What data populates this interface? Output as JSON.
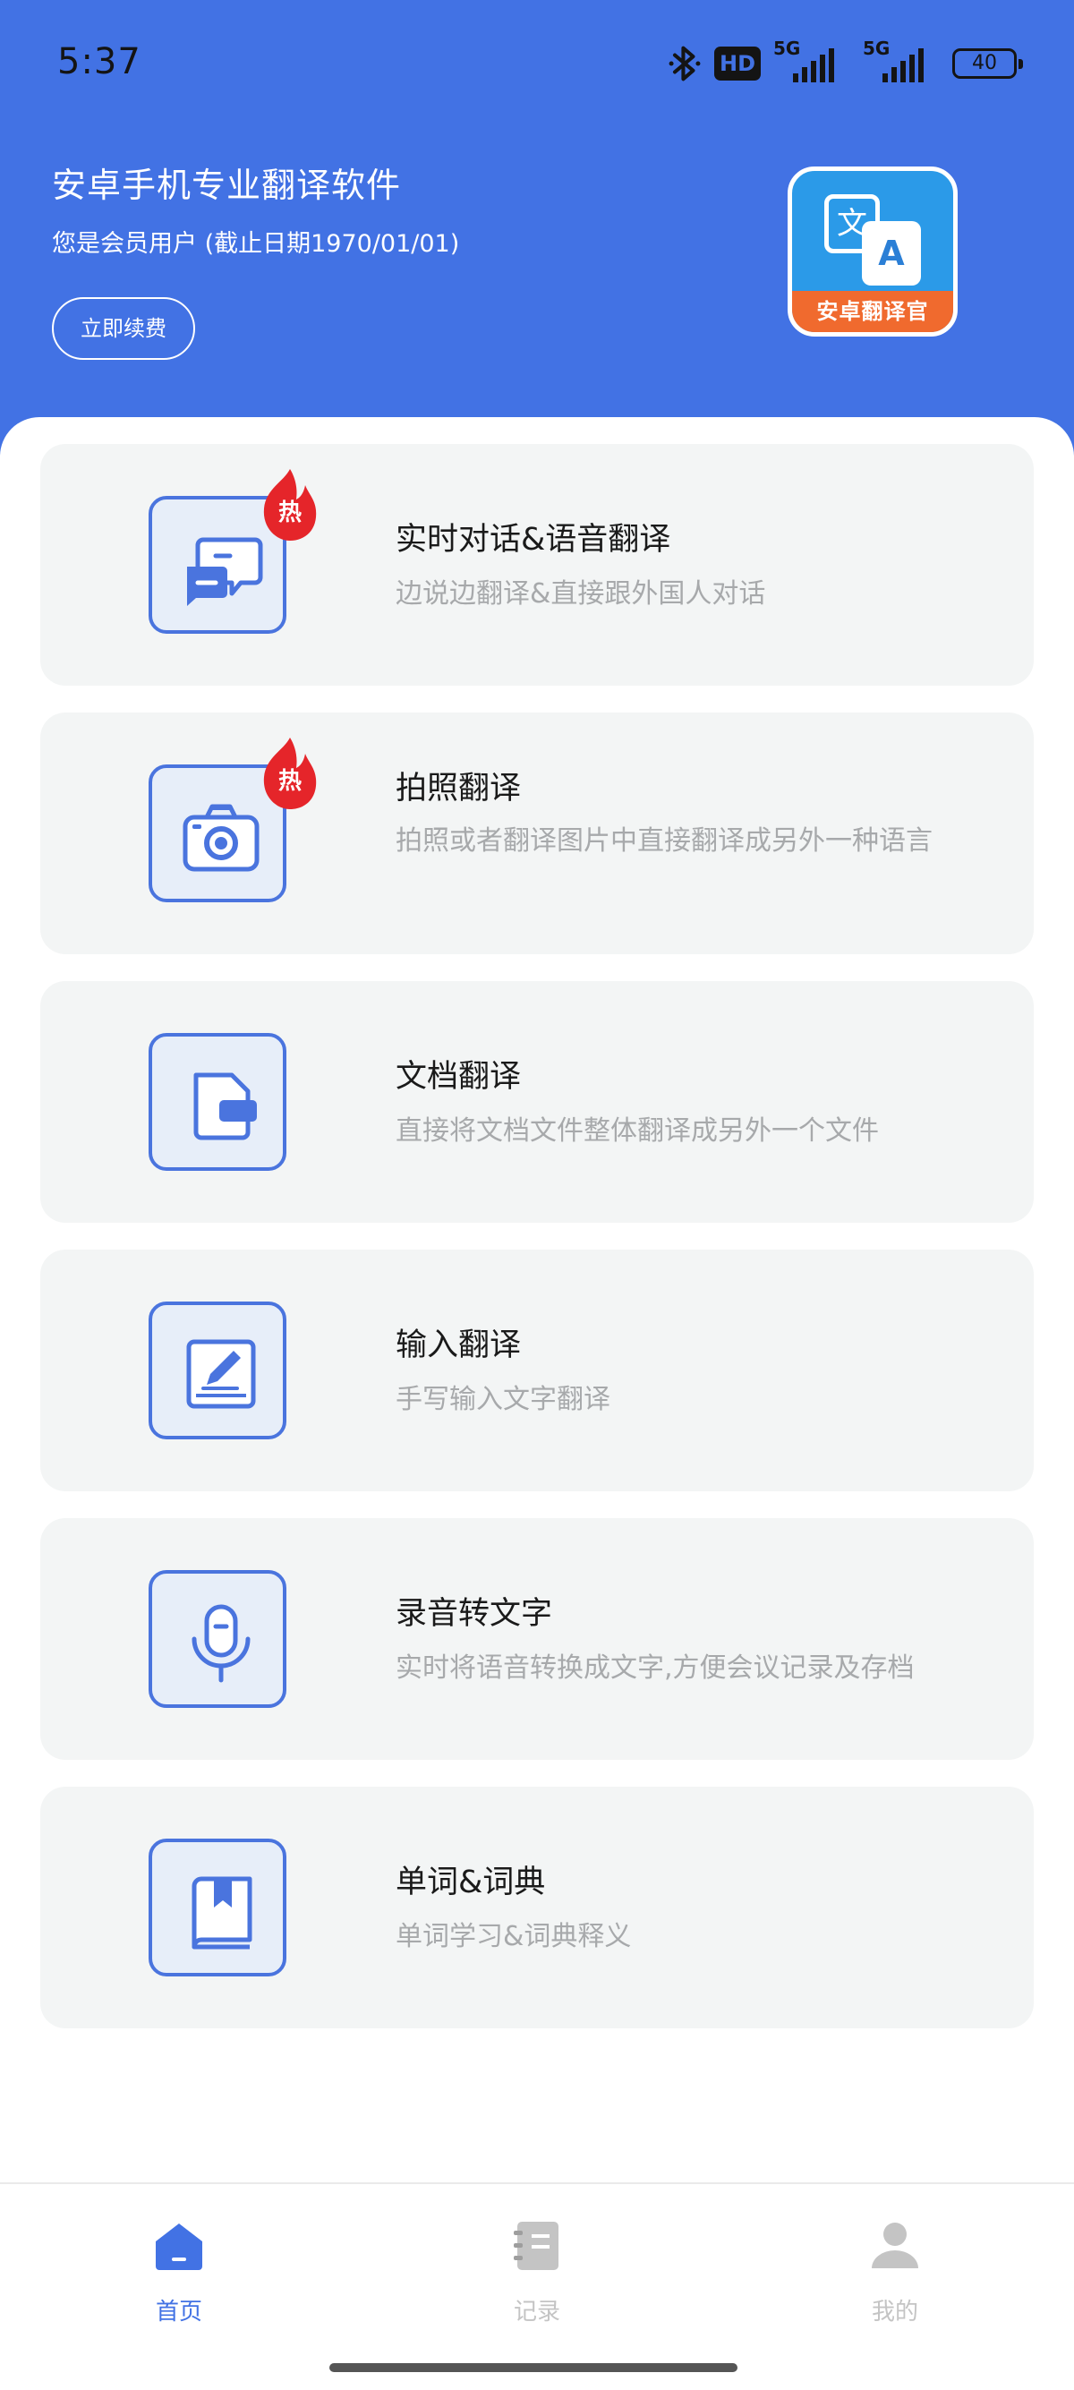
{
  "status_bar": {
    "time": "5:37",
    "hd_label": "HD",
    "network_1": "5G",
    "network_2": "5G",
    "battery": "40"
  },
  "header": {
    "title": "安卓手机专业翻译软件",
    "member_status": "您是会员用户 (截止日期1970/01/01)",
    "renew_button": "立即续费",
    "logo_text": "安卓翻译官",
    "logo_glyph_a": "文",
    "logo_glyph_b": "A"
  },
  "features": [
    {
      "title": "实时对话&语音翻译",
      "desc": "边说边翻译&直接跟外国人对话",
      "hot": "热",
      "icon": "chat-bubbles-icon"
    },
    {
      "title": "拍照翻译",
      "desc": "拍照或者翻译图片中直接翻译成另外一种语言",
      "hot": "热",
      "icon": "camera-icon"
    },
    {
      "title": "文档翻译",
      "desc": "直接将文档文件整体翻译成另外一个文件",
      "icon": "document-icon"
    },
    {
      "title": "输入翻译",
      "desc": "手写输入文字翻译",
      "icon": "edit-book-icon"
    },
    {
      "title": "录音转文字",
      "desc": "实时将语音转换成文字,方便会议记录及存档",
      "icon": "microphone-icon"
    },
    {
      "title": "单词&词典",
      "desc": "单词学习&词典释义",
      "icon": "dictionary-icon"
    }
  ],
  "bottom_nav": {
    "items": [
      {
        "label": "首页",
        "icon": "home-icon",
        "active": true
      },
      {
        "label": "记录",
        "icon": "records-icon",
        "active": false
      },
      {
        "label": "我的",
        "icon": "profile-icon",
        "active": false
      }
    ],
    "active_color": "#4272e4",
    "inactive_color": "#c4c4c4"
  },
  "colors": {
    "brand": "#4272e4",
    "icon_stroke": "#4a74de",
    "hot_badge": "#e5252a",
    "card_bg": "#f3f5f5"
  }
}
